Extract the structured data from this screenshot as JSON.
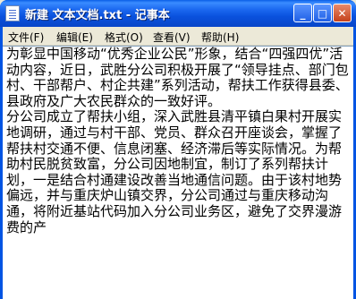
{
  "window": {
    "title": "新建 文本文档.txt - 记事本",
    "minimize_label": "_",
    "maximize_label": "□",
    "close_label": "✕"
  },
  "menubar": {
    "items": [
      "文件(F)",
      "编辑(E)",
      "格式(O)",
      "查看(V)",
      "帮助(H)"
    ]
  },
  "icons": {
    "app": "notepad-icon",
    "minimize": "minimize-icon",
    "maximize": "maximize-icon",
    "close": "close-icon"
  },
  "editor": {
    "text": "为彰显中国移动“优秀企业公民”形象，结合“四强四优”活动内容，近日，武胜分公司积极开展了“领导挂点、部门包村、干部帮户、村企共建”系列活动，帮扶工作获得县委、县政府及广大农民群众的一致好评。\n分公司成立了帮扶小组，深入武胜县清平镇白果村开展实地调研，通过与村干部、党员、群众召开座谈会，掌握了帮扶村交通不便、信息闭塞、经济滞后等实际情况。为帮助村民脱贫致富，分公司因地制宜，制订了系列帮扶计划，一是结合村通建设改善当地通信问题。由于该村地势偏远，并与重庆炉山镇交界，分公司通过与重庆移动沟通，将附近基站代码加入分公司业务区，避免了交界漫游费的产"
  }
}
